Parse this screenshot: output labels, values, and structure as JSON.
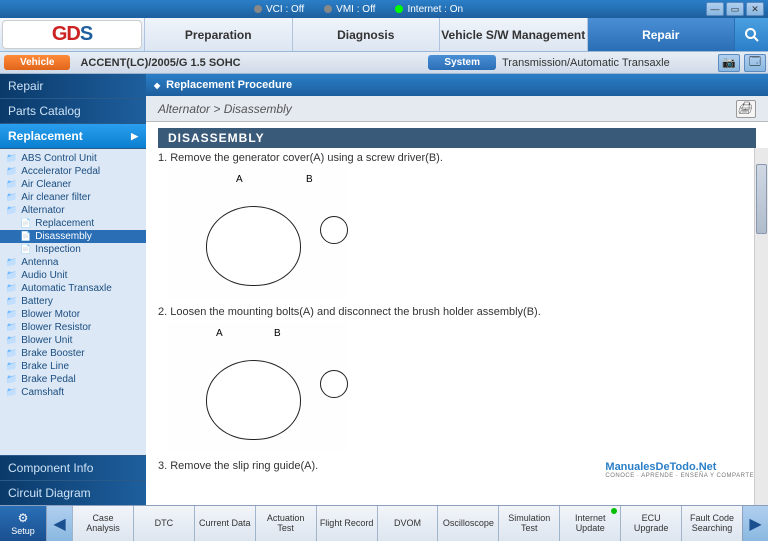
{
  "titlebar": {
    "status": [
      {
        "label": "VCI : Off",
        "on": false
      },
      {
        "label": "VMI : Off",
        "on": false
      },
      {
        "label": "Internet : On",
        "on": true
      }
    ]
  },
  "header": {
    "logo_left": "GD",
    "logo_right": "S",
    "tabs": [
      "Preparation",
      "Diagnosis",
      "Vehicle S/W Management",
      "Repair"
    ],
    "active_tab": 3
  },
  "vehicle_row": {
    "vehicle_btn": "Vehicle",
    "vehicle_text": "ACCENT(LC)/2005/G 1.5 SOHC",
    "system_btn": "System",
    "system_text": "Transmission/Automatic Transaxle"
  },
  "sidebar": {
    "sections_top": [
      "Repair",
      "Parts Catalog"
    ],
    "active_section": "Replacement",
    "tree": [
      "ABS Control Unit",
      "Accelerator Pedal",
      "Air Cleaner",
      "Air cleaner filter",
      "Alternator",
      "Antenna",
      "Audio Unit",
      "Automatic Transaxle",
      "Battery",
      "Blower Motor",
      "Blower Resistor",
      "Blower Unit",
      "Brake Booster",
      "Brake Line",
      "Brake Pedal",
      "Camshaft"
    ],
    "alternator_children": [
      "Replacement",
      "Disassembly",
      "Inspection"
    ],
    "alternator_selected": "Disassembly",
    "sections_bottom": [
      "Component Info",
      "Circuit Diagram"
    ]
  },
  "content": {
    "panel_title": "Replacement Procedure",
    "breadcrumb": "Alternator > Disassembly",
    "section_heading": "DISASSEMBLY",
    "steps": [
      "1. Remove the generator cover(A) using a screw driver(B).",
      "2. Loosen the mounting bolts(A) and disconnect the brush holder assembly(B).",
      "3. Remove the slip ring guide(A)."
    ],
    "step_labels": {
      "a": "A",
      "b": "B"
    }
  },
  "watermark": {
    "main": "ManualesDeTodo.Net",
    "sub": "CONOCE · APRENDE · ENSEÑA Y COMPARTE"
  },
  "bottom": {
    "setup": "Setup",
    "tabs": [
      "Case Analysis",
      "DTC",
      "Current Data",
      "Actuation Test",
      "Flight Record",
      "DVOM",
      "Oscilloscope",
      "Simulation Test",
      "Internet Update",
      "ECU Upgrade",
      "Fault Code Searching"
    ],
    "update_dot_index": 8
  }
}
